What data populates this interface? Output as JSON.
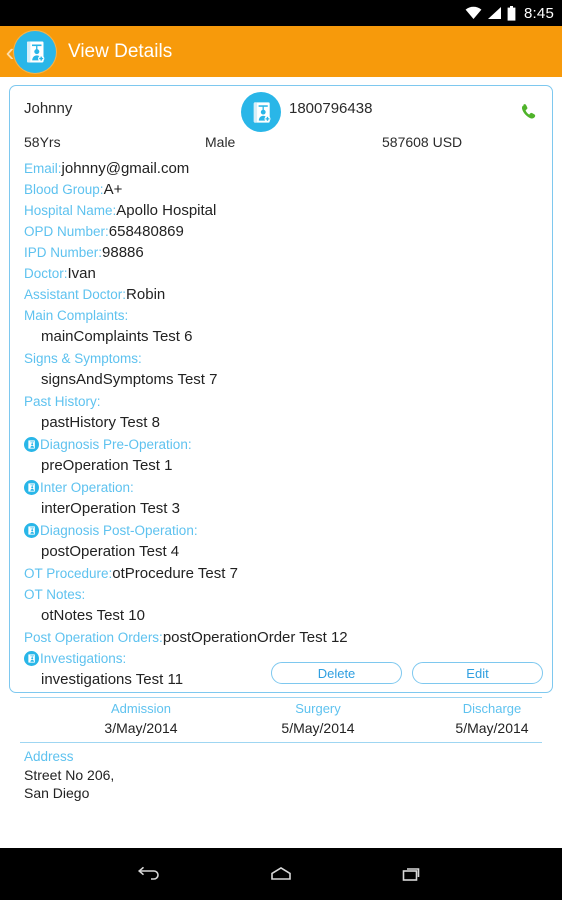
{
  "statusbar": {
    "time": "8:45",
    "icons": [
      "wifi-icon",
      "signal-icon",
      "battery-icon"
    ]
  },
  "appbar": {
    "back_label": "‹",
    "title": "View Details",
    "icon": "patient-file-badge-icon",
    "background": "#f79a0b"
  },
  "patient": {
    "name": "Johnny",
    "phone": "1800796438",
    "age": "58Yrs",
    "gender": "Male",
    "amount": "587608 USD",
    "call_icon": "phone-call-icon",
    "avatar_icon": "patient-file-badge-icon"
  },
  "fields": {
    "email_label": "Email:",
    "email_value": "johnny@gmail.com",
    "blood_group_label": "Blood Group:",
    "blood_group_value": "A+",
    "hospital_label": "Hospital Name:",
    "hospital_value": "Apollo Hospital",
    "opd_label": "OPD Number:",
    "opd_value": "658480869",
    "ipd_label": "IPD Number:",
    "ipd_value": "98886",
    "doctor_label": "Doctor:",
    "doctor_value": "Ivan",
    "assistant_label": "Assistant Doctor:",
    "assistant_value": "Robin",
    "main_complaints_label": "Main Complaints:",
    "main_complaints_value": "mainComplaints Test 6",
    "signs_label": "Signs & Symptoms:",
    "signs_value": "signsAndSymptoms Test 7",
    "past_history_label": "Past History:",
    "past_history_value": "pastHistory Test 8",
    "pre_op_label": "Diagnosis Pre-Operation:",
    "pre_op_value": "preOperation Test 1",
    "inter_op_label": "Inter Operation:",
    "inter_op_value": "interOperation Test 3",
    "post_op_label": "Diagnosis Post-Operation:",
    "post_op_value": "postOperation Test 4",
    "ot_procedure_label": "OT Procedure:",
    "ot_procedure_value": "otProcedure Test 7",
    "ot_notes_label": "OT Notes:",
    "ot_notes_value": "otNotes Test 10",
    "post_op_orders_label": "Post Operation Orders:",
    "post_op_orders_value": "postOperationOrder Test 12",
    "investigations_label": "Investigations:",
    "investigations_value": "investigations Test 11"
  },
  "dates": {
    "headers": [
      "Admission",
      "Surgery",
      "Discharge"
    ],
    "values": [
      "3/May/2014",
      "5/May/2014",
      "5/May/2014"
    ]
  },
  "address": {
    "label": "Address",
    "line1": "Street No 206,",
    "line2": "San Diego"
  },
  "actions": {
    "delete_label": "Delete",
    "edit_label": "Edit"
  },
  "navbar": {
    "back": "back-icon",
    "home": "home-icon",
    "recents": "recents-icon"
  },
  "colors": {
    "accent_orange": "#f79a0b",
    "accent_cyan": "#29b6e8",
    "label_blue": "#5ec2ef",
    "link_blue": "#2f9fe0",
    "call_green": "#4fb32a"
  }
}
